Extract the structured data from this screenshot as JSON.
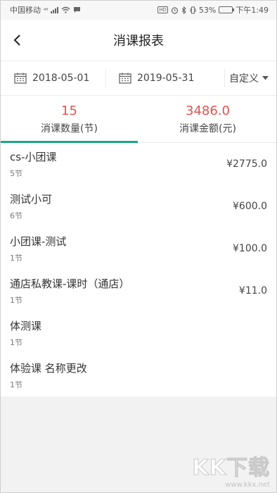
{
  "status_bar": {
    "carrier": "中国移动",
    "network": "⁴⁶",
    "battery": "53%",
    "time": "下午1:49",
    "hd": "HD"
  },
  "nav": {
    "title": "消课报表"
  },
  "dates": {
    "start": "2018-05-01",
    "end": "2019-05-31",
    "custom_label": "自定义"
  },
  "tabs": [
    {
      "value": "15",
      "label": "消课数量(节)"
    },
    {
      "value": "3486.0",
      "label": "消课金额(元)"
    }
  ],
  "courses": [
    {
      "name": "cs-小团课",
      "count": "5节",
      "amount": "¥2775.0"
    },
    {
      "name": "测试小可",
      "count": "6节",
      "amount": "¥600.0"
    },
    {
      "name": "小团课-测试",
      "count": "1节",
      "amount": "¥100.0"
    },
    {
      "name": "通店私教课-课时（通店）",
      "count": "1节",
      "amount": "¥11.0"
    },
    {
      "name": "体测课",
      "count": "1节",
      "amount": ""
    },
    {
      "name": "体验课 名称更改",
      "count": "1节",
      "amount": ""
    }
  ],
  "watermark": {
    "brand": "KK下载",
    "url": "www.kkx.net"
  },
  "colors": {
    "accent": "#e8514e",
    "tab_indicator": "#1aa589"
  }
}
